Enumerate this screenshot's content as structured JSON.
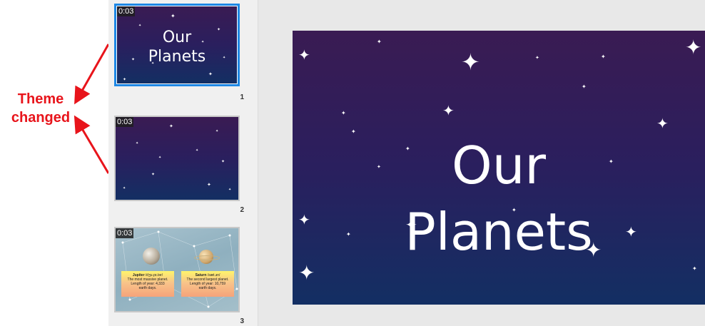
{
  "annotation": {
    "line1": "Theme",
    "line2": "changed",
    "color": "#e8141b"
  },
  "thumbnails": [
    {
      "number": "1",
      "timing": "0:03",
      "title_line1": "Our",
      "title_line2": "Planets",
      "selected": true
    },
    {
      "number": "2",
      "timing": "0:03",
      "selected": false
    },
    {
      "number": "3",
      "timing": "0:03",
      "selected": false,
      "planets": [
        {
          "name": "Jupiter",
          "pronunciation": "/dʒu.pɪ.tər/",
          "line1": "The most massive planet.",
          "line2": "Length of year: 4,333",
          "line3": "earth days."
        },
        {
          "name": "Saturn",
          "pronunciation": "/sæt.ɜn/",
          "line1": "The second largest planet.",
          "line2": "Length of year: 10,759",
          "line3": "earth days."
        }
      ]
    }
  ],
  "slide": {
    "title_line1": "Our",
    "title_line2": "Planets"
  },
  "colors": {
    "selection": "#1e88e5",
    "slide_top": "#3a1b53",
    "slide_bottom": "#132f63"
  }
}
